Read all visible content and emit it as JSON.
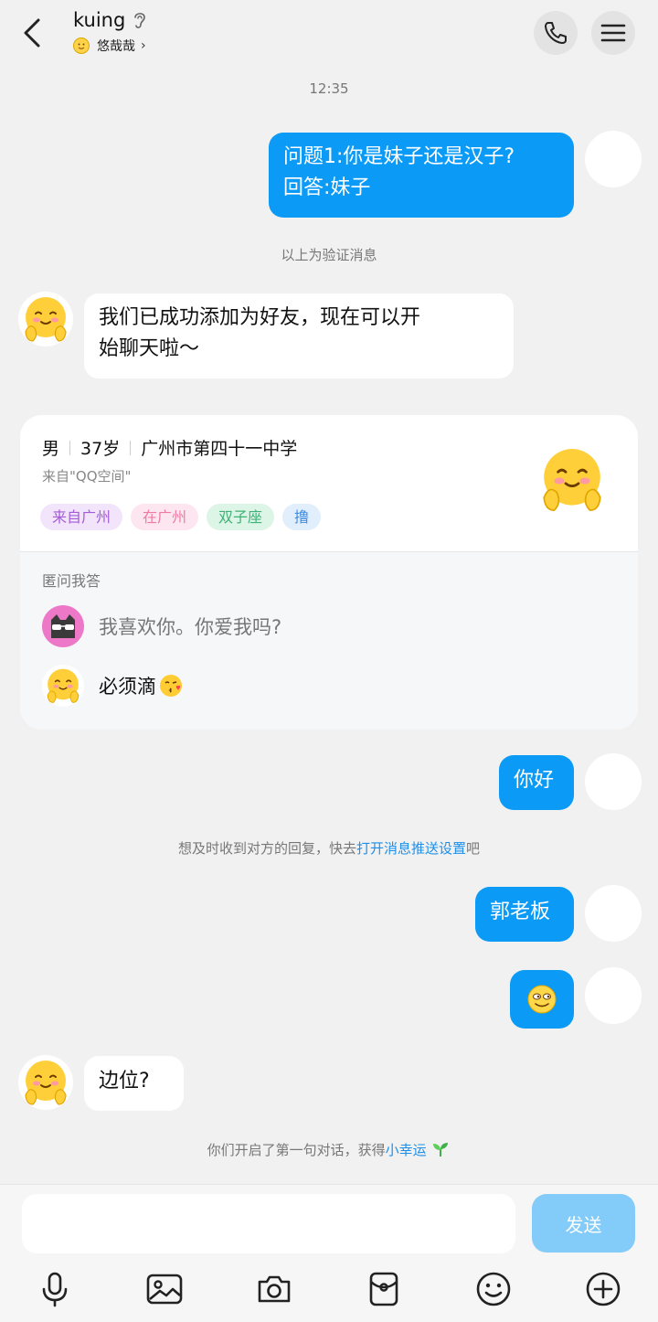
{
  "header": {
    "title": "kuing",
    "subtitle": "悠哉哉",
    "back_icon": "back-arrow-icon",
    "call_icon": "phone-icon",
    "menu_icon": "menu-icon"
  },
  "messages": {
    "time": "12:35",
    "verify_question": "问题1:你是妹子还是汉子?",
    "verify_answer": "回答:妹子",
    "verify_note": "以上为验证消息",
    "added_line1": "我们已成功添加为好友，现在可以开",
    "added_line2": "始聊天啦～",
    "hello": "你好",
    "push_hint_prefix": "想及时收到对方的回复，快去",
    "push_hint_link": "打开消息推送设置",
    "push_hint_suffix": "吧",
    "guo": "郭老板",
    "reply": "边位?",
    "lucky_prefix": "你们开启了第一句对话，获得",
    "lucky_link": "小幸运"
  },
  "profile_card": {
    "gender": "男",
    "age": "37岁",
    "school": "广州市第四十一中学",
    "source": "来自\"QQ空间\"",
    "tags": [
      "来自广州",
      "在广州",
      "双子座",
      "撸"
    ],
    "qa_title": "匿问我答",
    "question": "我喜欢你。你爱我吗?",
    "answer": "必须滴"
  },
  "input": {
    "placeholder": "",
    "send_label": "发送"
  },
  "toolbar": [
    "mic-icon",
    "image-icon",
    "camera-icon",
    "red-packet-icon",
    "emoji-icon",
    "plus-icon"
  ],
  "colors": {
    "accent": "#0b9bf7",
    "send_disabled": "#83cbf8",
    "link": "#1e8fe8",
    "background": "#f1f1f1"
  }
}
